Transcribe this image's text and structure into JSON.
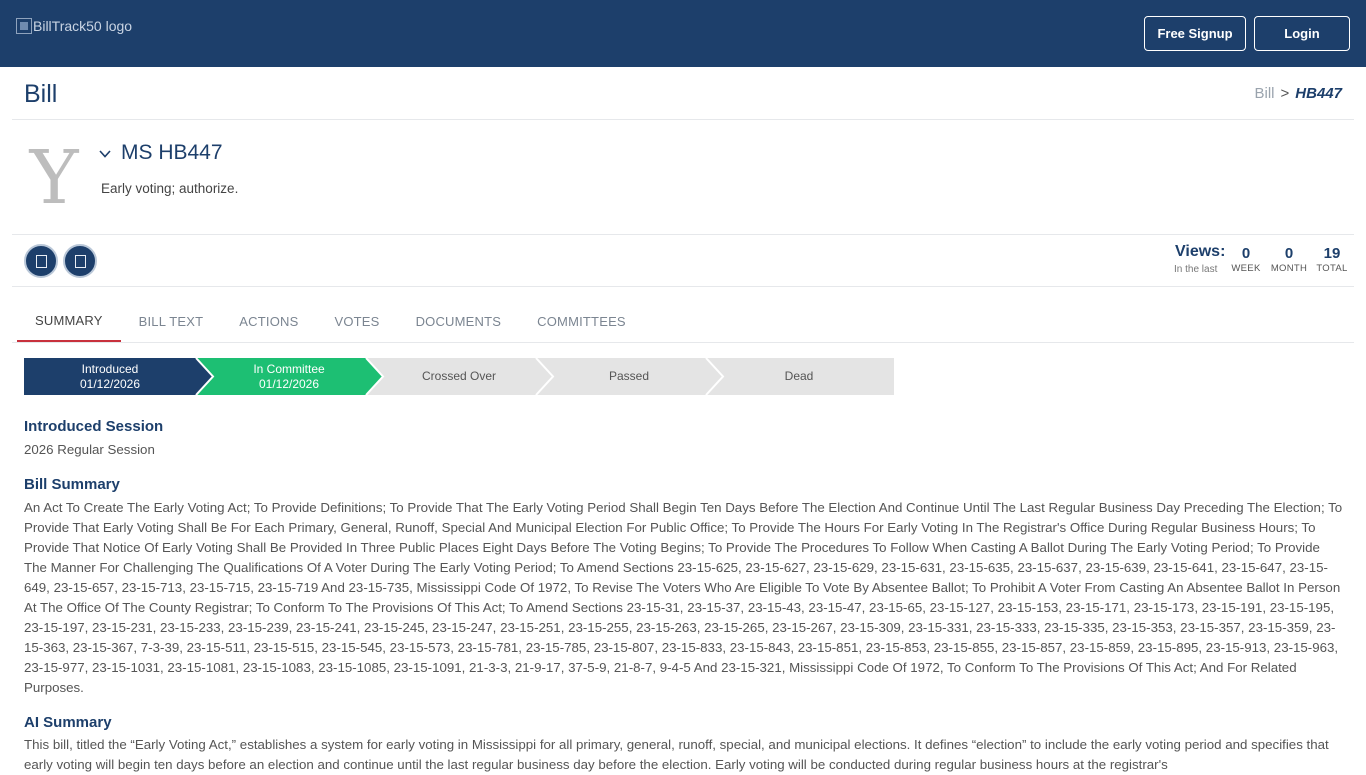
{
  "topnav": {
    "logo_alt": "BillTrack50 logo",
    "signup_label": "Free Signup",
    "login_label": "Login"
  },
  "page": {
    "title": "Bill",
    "breadcrumb": {
      "root": "Bill",
      "separator": ">",
      "current": "HB447"
    }
  },
  "bill": {
    "state_letter": "Y",
    "id": "MS HB447",
    "description": "Early voting; authorize."
  },
  "views": {
    "label": "Views:",
    "sublabel": "In the last",
    "stats": [
      {
        "value": "0",
        "label": "WEEK"
      },
      {
        "value": "0",
        "label": "MONTH"
      },
      {
        "value": "19",
        "label": "TOTAL"
      }
    ]
  },
  "tabs": [
    "SUMMARY",
    "BILL TEXT",
    "ACTIONS",
    "VOTES",
    "DOCUMENTS",
    "COMMITTEES"
  ],
  "active_tab": "SUMMARY",
  "progress": [
    {
      "label": "Introduced",
      "date": "01/12/2026",
      "state": "done",
      "color": "#1d3f6b"
    },
    {
      "label": "In Committee",
      "date": "01/12/2026",
      "state": "current",
      "color": "#1dbf73"
    },
    {
      "label": "Crossed Over",
      "date": "",
      "state": "pending",
      "color": "#e4e4e4"
    },
    {
      "label": "Passed",
      "date": "",
      "state": "pending",
      "color": "#e4e4e4"
    },
    {
      "label": "Dead",
      "date": "",
      "state": "pending",
      "color": "#e4e4e4"
    }
  ],
  "sections": {
    "session_heading": "Introduced Session",
    "session_text": "2026 Regular Session",
    "summary_heading": "Bill Summary",
    "summary_text": "An Act To Create The Early Voting Act; To Provide Definitions; To Provide That The Early Voting Period Shall Begin Ten Days Before The Election And Continue Until The Last Regular Business Day Preceding The Election; To Provide That Early Voting Shall Be For Each Primary, General, Runoff, Special And Municipal Election For Public Office; To Provide The Hours For Early Voting In The Registrar's Office During Regular Business Hours; To Provide That Notice Of Early Voting Shall Be Provided In Three Public Places Eight Days Before The Voting Begins; To Provide The Procedures To Follow When Casting A Ballot During The Early Voting Period; To Provide The Manner For Challenging The Qualifications Of A Voter During The Early Voting Period; To Amend Sections 23-15-625, 23-15-627, 23-15-629, 23-15-631, 23-15-635, 23-15-637, 23-15-639, 23-15-641, 23-15-647, 23-15-649, 23-15-657, 23-15-713, 23-15-715, 23-15-719 And 23-15-735, Mississippi Code Of 1972, To Revise The Voters Who Are Eligible To Vote By Absentee Ballot; To Prohibit A Voter From Casting An Absentee Ballot In Person At The Office Of The County Registrar; To Conform To The Provisions Of This Act; To Amend Sections 23-15-31, 23-15-37, 23-15-43, 23-15-47, 23-15-65, 23-15-127, 23-15-153, 23-15-171, 23-15-173, 23-15-191, 23-15-195, 23-15-197, 23-15-231, 23-15-233, 23-15-239, 23-15-241, 23-15-245, 23-15-247, 23-15-251, 23-15-255, 23-15-263, 23-15-265, 23-15-267, 23-15-309, 23-15-331, 23-15-333, 23-15-335, 23-15-353, 23-15-357, 23-15-359, 23-15-363, 23-15-367, 7-3-39, 23-15-511, 23-15-515, 23-15-545, 23-15-573, 23-15-781, 23-15-785, 23-15-807, 23-15-833, 23-15-843, 23-15-851, 23-15-853, 23-15-855, 23-15-857, 23-15-859, 23-15-895, 23-15-913, 23-15-963, 23-15-977, 23-15-1031, 23-15-1081, 23-15-1083, 23-15-1085, 23-15-1091, 21-3-3, 21-9-17, 37-5-9, 21-8-7, 9-4-5 And 23-15-321, Mississippi Code Of 1972, To Conform To The Provisions Of This Act; And For Related Purposes.",
    "ai_heading": "AI Summary",
    "ai_text": "This bill, titled the “Early Voting Act,” establishes a system for early voting in Mississippi for all primary, general, runoff, special, and municipal elections. It defines “election” to include the early voting period and specifies that early voting will begin ten days before an election and continue until the last regular business day before the election. Early voting will be conducted during regular business hours at the registrar's"
  },
  "icons": {
    "chevron": "chevron-down-icon",
    "action_1": "bookmark-icon",
    "action_2": "share-icon"
  },
  "colors": {
    "navy": "#1d3f6b",
    "green": "#1dbf73",
    "red_tab": "#c8313d",
    "pending": "#e4e4e4"
  }
}
